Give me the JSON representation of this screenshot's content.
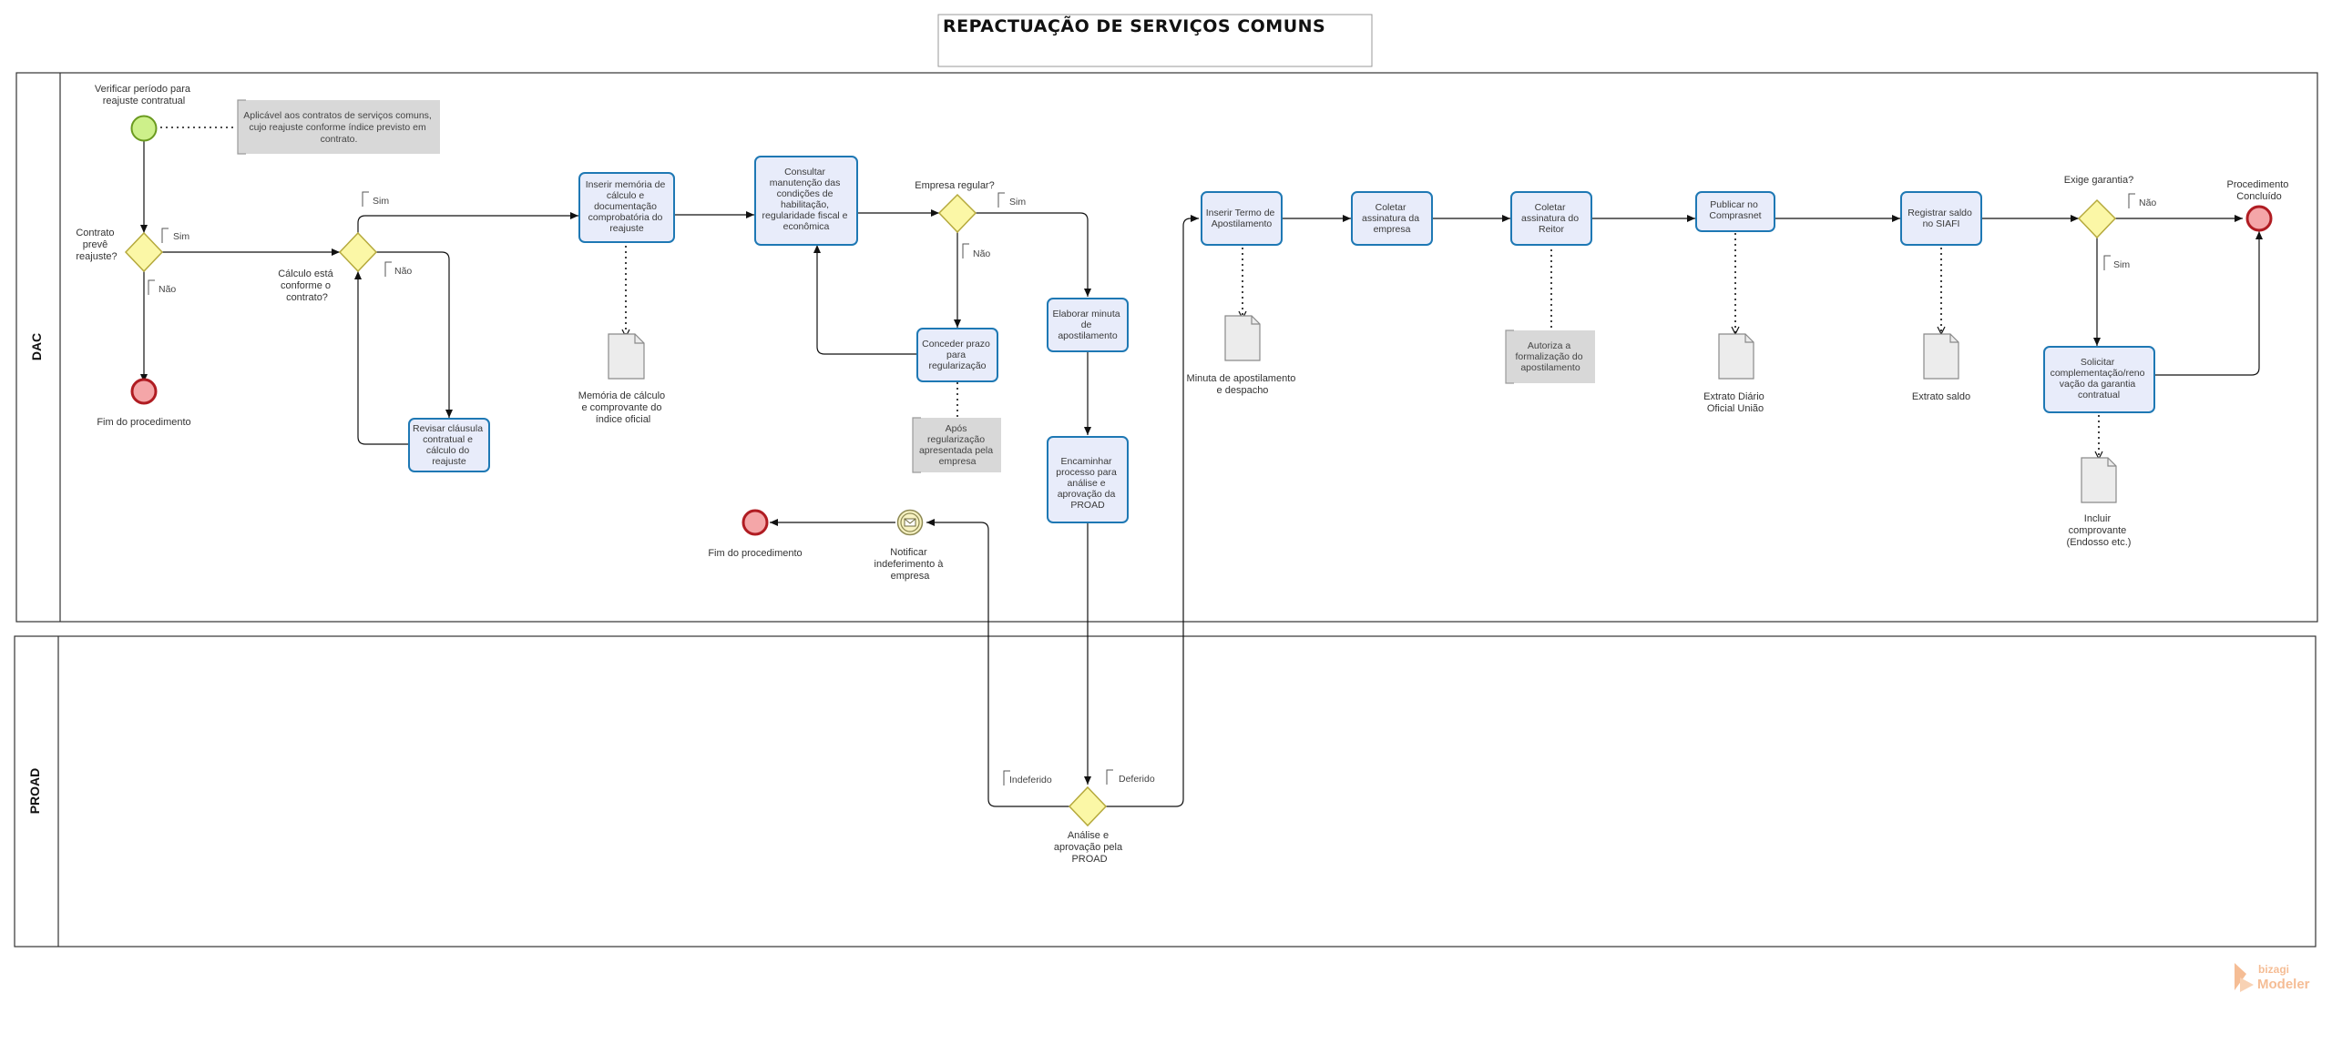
{
  "title": "REPACTUAÇÃO DE SERVIÇOS COMUNS",
  "lanes": {
    "dac": "DAC",
    "proad": "PROAD"
  },
  "events": {
    "start": "Verificar período para reajuste contratual",
    "end_no_reajuste": "Fim do procedimento",
    "end_indeferido": "Fim do procedimento",
    "end_concluido": "Procedimento Concluído",
    "notify": "Notificar indeferimento à empresa"
  },
  "gateways": {
    "contrato": "Contrato prevê reajuste?",
    "calculo": "Cálculo está conforme o contrato?",
    "empresa": "Empresa regular?",
    "garantia": "Exige garantia?",
    "proad": "Análise e aprovação pela PROAD"
  },
  "tasks": {
    "revisar": "Revisar cláusula contratual e cálculo do reajuste",
    "inserir_memoria": "Inserir memória de cálculo e documentação comprobatória do reajuste",
    "consultar": "Consultar manutenção das condições de habilitação, regularidade fiscal e econômica",
    "conceder": "Conceder prazo para regularização",
    "elaborar": "Elaborar minuta de apostilamento",
    "encaminhar": "Encaminhar processo para análise e aprovação da PROAD",
    "inserir_termo": "Inserir Termo de Apostilamento",
    "coletar_empresa": "Coletar assinatura da empresa",
    "coletar_reitor": "Coletar assinatura do Reitor",
    "publicar": "Publicar no Comprasnet",
    "registrar": "Registrar saldo no SIAFI",
    "solicitar": "Solicitar complementação/renovação da garantia contratual"
  },
  "documents": {
    "memoria": "Memória de cálculo e comprovante do índice oficial",
    "minuta": "Minuta de apostilamento e despacho",
    "extrato_diario": "Extrato Diário Oficial União",
    "extrato_saldo": "Extrato saldo",
    "comprovante": "Incluir comprovante (Endosso etc.)"
  },
  "annotations": {
    "aplicavel": "Aplicável aos contratos de serviços comuns, cujo reajuste conforme índice previsto em contrato.",
    "apos": "Após regularização apresentada pela empresa",
    "autoriza": "Autoriza a formalização do apostilamento"
  },
  "flow_labels": {
    "contrato_sim": "Sim",
    "contrato_nao": "Não",
    "calculo_sim": "Sim",
    "calculo_nao": "Não",
    "empresa_sim": "Sim",
    "empresa_nao": "Não",
    "garantia_nao": "Não",
    "garantia_sim": "Sim",
    "indeferido": "Indeferido",
    "deferido": "Deferido"
  },
  "brand": {
    "name_top": "bizagi",
    "name_bottom": "Modeler",
    "color": "#f2a772"
  },
  "colors": {
    "task_fill": "#e8ecfa",
    "task_stroke": "#1e78b4",
    "gateway_fill": "#fbf7a6",
    "start_fill": "#cdf08a",
    "end_fill": "#f4a6a8",
    "annotation_fill": "#d8d8d8"
  }
}
